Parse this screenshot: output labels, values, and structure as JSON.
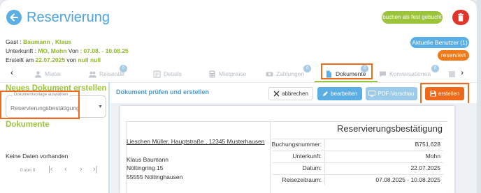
{
  "header": {
    "title": "Reservierung",
    "fixed_button": "buchen als fest gebucht"
  },
  "info": {
    "guest_label": "Gast : ",
    "guest_value": "Baumann , Klaus",
    "accommodation_label": "Unterkunft : ",
    "accommodation_value": "MO, Mohn",
    "from_label": " Von : ",
    "from_value": "07.08. - 10.08.25",
    "created_label": "Erstellt am ",
    "created_value": "22.07.2025",
    "created_by_label": " von ",
    "created_by_value": "null null"
  },
  "badges": {
    "users_button": "Aktuelle Benutzer (1)",
    "status": "reserviert"
  },
  "tabs": [
    {
      "label": "Mieter",
      "icon": "person-icon"
    },
    {
      "label": "Reisende",
      "icon": "group-icon",
      "badge": "0"
    },
    {
      "label": "Details",
      "icon": "list-icon"
    },
    {
      "label": "Mietpreise",
      "icon": "calculator-icon"
    },
    {
      "label": "Zahlungen",
      "icon": "money-icon",
      "badge": "0"
    },
    {
      "label": "Dokumente",
      "icon": "document-icon",
      "badge": "0",
      "active": true
    },
    {
      "label": "Konversationen",
      "icon": "chat-icon",
      "badge": "0"
    }
  ],
  "sidebar": {
    "new_doc_title": "Neues Dokument erstellen",
    "template_label": "Dokumentvorlage auswählen",
    "template_value": "Reservierungsbestätigung",
    "documents_title": "Dokumente",
    "no_data": "Keine Daten vorhanden",
    "pager_count": "0 von 0"
  },
  "main": {
    "title": "Dokument prüfen und erstellen",
    "cancel_button": "abbrechen",
    "edit_button": "bearbeiten",
    "preview_button": "PDF-Vorschau",
    "create_button": "erstellen"
  },
  "document": {
    "title": "Reservierungsbestätigung",
    "sender": "Lieschen Müller, Hauptstraße , 12345 Musterhausen",
    "recipient_name": "Klaus Baumann",
    "recipient_street": "Nöltingring 15",
    "recipient_city": "55555 Nöltinghausen",
    "rows": [
      {
        "label": "Buchungsnummer:",
        "value": "B751.628"
      },
      {
        "label": "Unterkunft:",
        "value": "Mohn"
      },
      {
        "label": "Datum:",
        "value": "22.07.2025"
      },
      {
        "label": "Reisezeitraum:",
        "value": "07.08.2025 - 10.08.2025"
      }
    ]
  },
  "colors": {
    "accent_blue": "#4aa3df",
    "accent_green": "#9cc43a",
    "accent_orange": "#ee6a1a",
    "danger_red": "#e0352b"
  }
}
